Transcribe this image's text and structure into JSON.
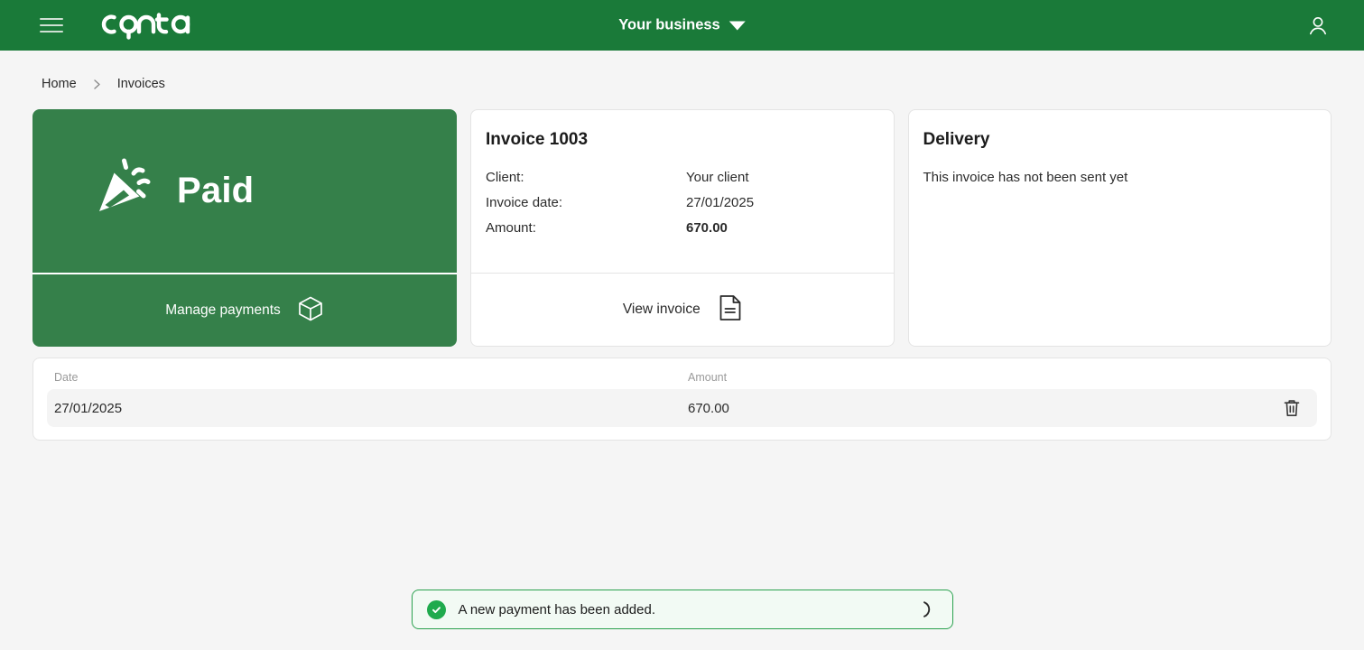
{
  "header": {
    "menu_icon": "hamburger-icon",
    "logo_text": "conta",
    "business_switcher": "Your business",
    "caret_icon": "caret-down-icon",
    "user_icon": "user-icon"
  },
  "breadcrumb": {
    "items": [
      {
        "label": "Home"
      },
      {
        "label": "Invoices"
      }
    ],
    "separator_icon": "chevron-right-icon"
  },
  "status_card": {
    "icon": "party-popper-icon",
    "status_label": "Paid",
    "action_label": "Manage payments",
    "action_icon": "box-icon",
    "background_color": "#35804a"
  },
  "invoice_card": {
    "title": "Invoice 1003",
    "rows": [
      {
        "key": "Client:",
        "value": "Your client"
      },
      {
        "key": "Invoice date:",
        "value": "27/01/2025"
      },
      {
        "key": "Amount:",
        "value": "670.00"
      }
    ],
    "action_label": "View invoice",
    "action_icon": "document-icon"
  },
  "delivery_card": {
    "title": "Delivery",
    "message": "This invoice has not been sent yet"
  },
  "payments_table": {
    "columns": [
      {
        "label": "Date"
      },
      {
        "label": "Amount"
      }
    ],
    "rows": [
      {
        "date": "27/01/2025",
        "amount": "670.00",
        "delete_icon": "trash-icon"
      }
    ]
  },
  "toast": {
    "icon": "check-circle-icon",
    "message": "A new payment has been added.",
    "spinner_icon": "spinner-icon",
    "border_color": "#2aa14e",
    "accent_color": "#1faa4d"
  },
  "theme": {
    "header_green": "#1a7a39",
    "card_green": "#35804a",
    "page_background": "#f5f5f5"
  }
}
